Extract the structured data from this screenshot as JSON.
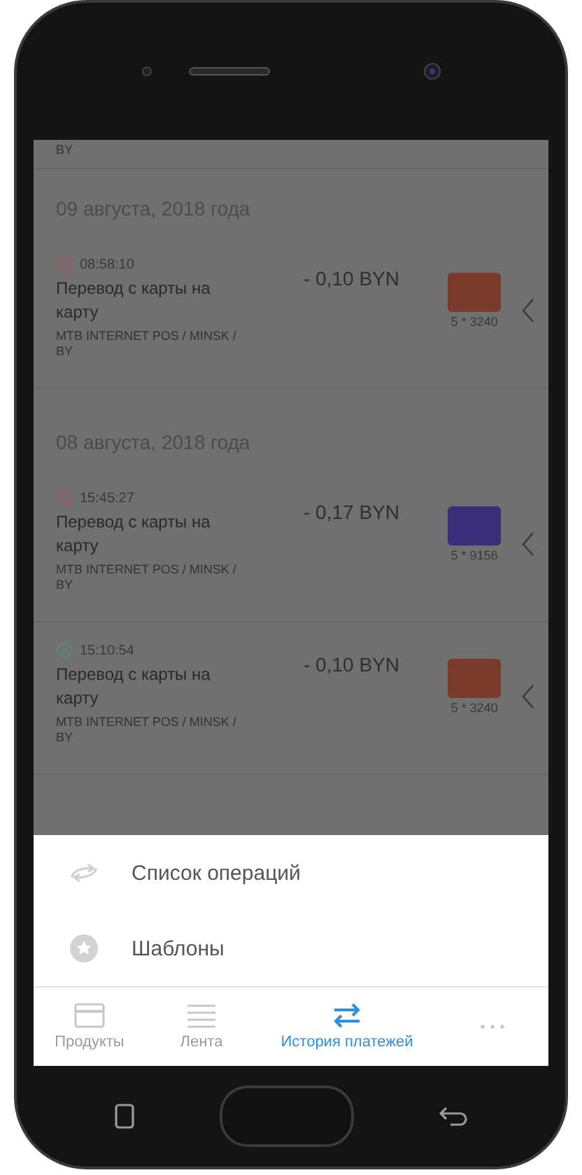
{
  "list": {
    "partial_text": "BY",
    "groups": [
      {
        "date": "09 августа, 2018 года",
        "operations": [
          {
            "kind": "error",
            "time": "08:58:10",
            "title": "Перевод с карты на карту",
            "merchant": "MTB INTERNET POS / MINSK / BY",
            "amount": "- 0,10 BYN",
            "card": {
              "color": "#7a3a2c",
              "number": "5 * 3240"
            }
          }
        ]
      },
      {
        "date": "08 августа, 2018 года",
        "operations": [
          {
            "kind": "error",
            "time": "15:45:27",
            "title": "Перевод с карты на карту",
            "merchant": "MTB INTERNET POS / MINSK / BY",
            "amount": "- 0,17 BYN",
            "card": {
              "color": "#3b2f7a",
              "number": "5 * 9156"
            }
          },
          {
            "kind": "done",
            "time": "15:10:54",
            "title": "Перевод с карты на карту",
            "merchant": "MTB INTERNET POS / MINSK / BY",
            "amount": "- 0,10 BYN",
            "card": {
              "color": "#7a3a2c",
              "number": "5 * 3240"
            }
          }
        ]
      }
    ]
  },
  "sheet": {
    "items": [
      {
        "kind": "operations",
        "label": "Список операций"
      },
      {
        "kind": "templates",
        "label": "Шаблоны"
      }
    ]
  },
  "tabs": [
    {
      "kind": "products",
      "label": "Продукты",
      "selected": false
    },
    {
      "kind": "feed",
      "label": "Лента",
      "selected": false
    },
    {
      "kind": "history",
      "label": "История платежей",
      "selected": true
    },
    {
      "kind": "more",
      "selected": false
    }
  ]
}
